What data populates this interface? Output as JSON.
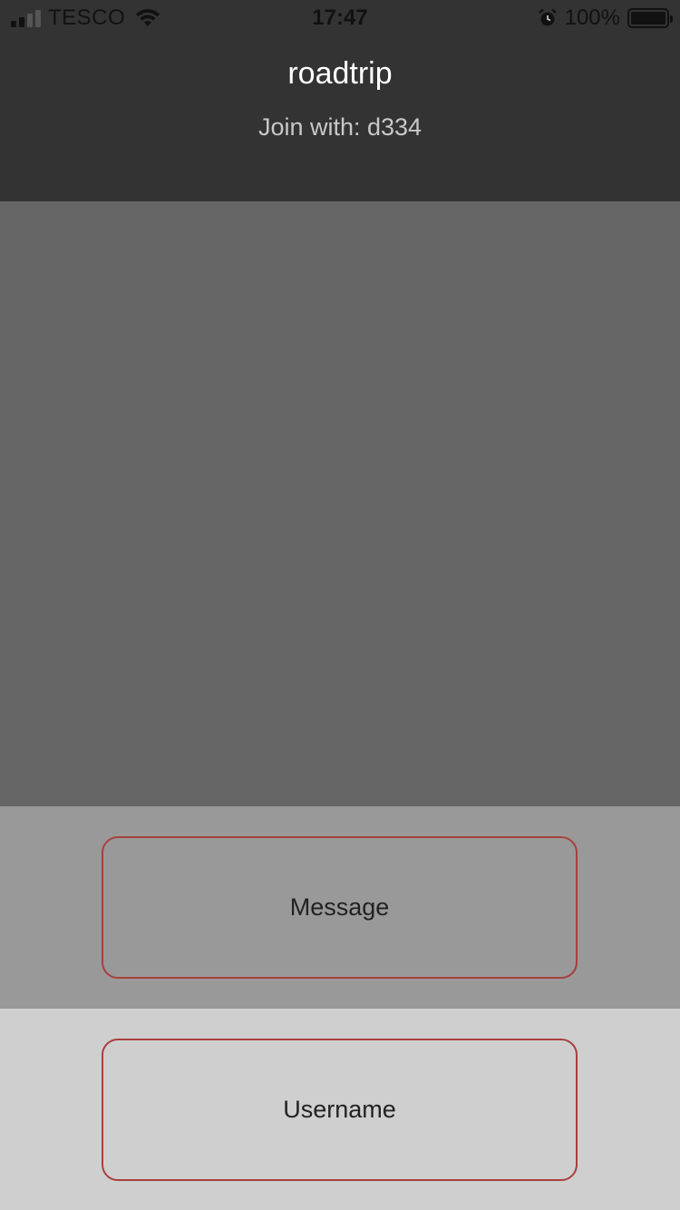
{
  "status_bar": {
    "carrier": "TESCO",
    "time": "17:47",
    "battery_percent": "100%",
    "battery_level": 1.0,
    "signal_bars_active": 2,
    "signal_bars_total": 4,
    "icons": [
      "signal-icon",
      "wifi-icon",
      "alarm-icon",
      "battery-icon"
    ]
  },
  "header": {
    "title": "roadtrip",
    "subtitle": "Join with: d334"
  },
  "message_input": {
    "placeholder": "Message"
  },
  "username_input": {
    "placeholder": "Username"
  },
  "colors": {
    "header_bg": "#333333",
    "messages_bg": "#666666",
    "message_bar_bg": "#999999",
    "username_bar_bg": "#cfcfcf",
    "field_border": "#a8403e"
  }
}
